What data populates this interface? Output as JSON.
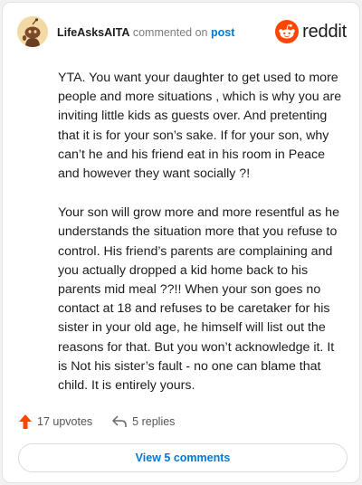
{
  "comment": {
    "username": "LifeAsksAITA",
    "action_text": "commented on",
    "post_link": "post",
    "paragraphs": [
      "YTA. You want your daughter to get used to more people and more situations , which is why you are inviting little kids as guests over. And pretenting that it is for your son’s sake. If for your son, why can’t he and his friend eat in his room in Peace and however they want socially ?!",
      "Your son will grow more and more resentful as he understands the situation more that you refuse to control. His friend’s parents are complaining and you actually dropped a kid home back to his parents mid meal ??!! When your son goes no contact at 18 and refuses to be caretaker for his sister in your old age, he himself will list out the reasons for that. But you won’t acknowledge it. It is Not his sister’s fault - no one can blame that child. It is entirely yours."
    ]
  },
  "brand": {
    "name": "reddit",
    "accent_color": "#ff4500"
  },
  "stats": {
    "upvotes": "17 upvotes",
    "replies": "5 replies"
  },
  "footer": {
    "view_comments": "View 5 comments"
  },
  "icons": {
    "avatar": "snoo-avatar",
    "logo": "reddit-alien-icon",
    "upvote": "upvote-arrow-icon",
    "reply": "reply-arrow-icon"
  }
}
